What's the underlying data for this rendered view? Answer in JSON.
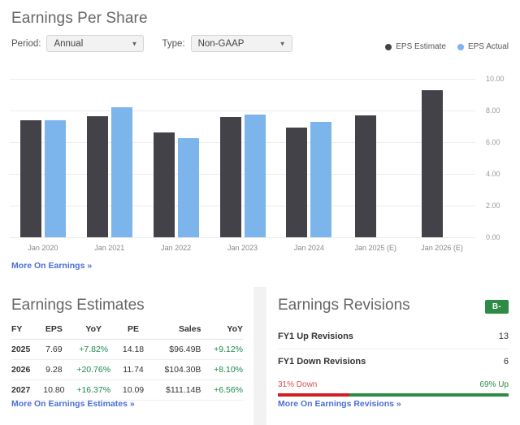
{
  "chart_panel": {
    "title": "Earnings Per Share",
    "controls": {
      "period_label": "Period:",
      "period_value": "Annual",
      "type_label": "Type:",
      "type_value": "Non-GAAP",
      "caret_icon": "chevron-down-icon"
    },
    "more_link": "More On Earnings »"
  },
  "chart_data": {
    "type": "bar",
    "title": "Earnings Per Share",
    "xlabel": "",
    "ylabel": "",
    "ylim": [
      0,
      10
    ],
    "yticks": [
      "0.00",
      "2.00",
      "4.00",
      "6.00",
      "8.00",
      "10.00"
    ],
    "ytick_values": [
      0,
      2,
      4,
      6,
      8,
      10
    ],
    "grid": true,
    "legend_position": "top-right",
    "categories": [
      "Jan 2020",
      "Jan 2021",
      "Jan 2022",
      "Jan 2023",
      "Jan 2024",
      "Jan 2025 (E)",
      "Jan 2026 (E)"
    ],
    "series": [
      {
        "name": "EPS Estimate",
        "color": "#434248",
        "values": [
          7.38,
          7.64,
          6.62,
          7.59,
          6.92,
          7.69,
          9.28
        ]
      },
      {
        "name": "EPS Actual",
        "color": "#7cb4ec",
        "values": [
          7.38,
          8.21,
          6.26,
          7.74,
          7.28,
          null,
          null
        ]
      }
    ]
  },
  "estimates_panel": {
    "title": "Earnings Estimates",
    "columns": [
      "FY",
      "EPS",
      "YoY",
      "PE",
      "Sales",
      "YoY"
    ],
    "rows": [
      {
        "fy": "2025",
        "eps": "7.69",
        "eps_yoy": "+7.82%",
        "pe": "14.18",
        "sales": "$96.49B",
        "sales_yoy": "+9.12%"
      },
      {
        "fy": "2026",
        "eps": "9.28",
        "eps_yoy": "+20.76%",
        "pe": "11.74",
        "sales": "$104.30B",
        "sales_yoy": "+8.10%"
      },
      {
        "fy": "2027",
        "eps": "10.80",
        "eps_yoy": "+16.37%",
        "pe": "10.09",
        "sales": "$111.14B",
        "sales_yoy": "+6.56%"
      }
    ],
    "more_link": "More On Earnings Estimates »"
  },
  "revisions_panel": {
    "title": "Earnings Revisions",
    "grade": "B-",
    "grade_color": "#2e8b45",
    "up_label": "FY1 Up Revisions",
    "up_value": "13",
    "down_label": "FY1 Down Revisions",
    "down_value": "6",
    "split_down_label": "31% Down",
    "split_up_label": "69% Up",
    "split_down_pct": 31,
    "split_up_pct": 69,
    "down_color": "#d01f27",
    "up_color": "#2e8b45",
    "more_link": "More On Earnings Revisions »"
  }
}
